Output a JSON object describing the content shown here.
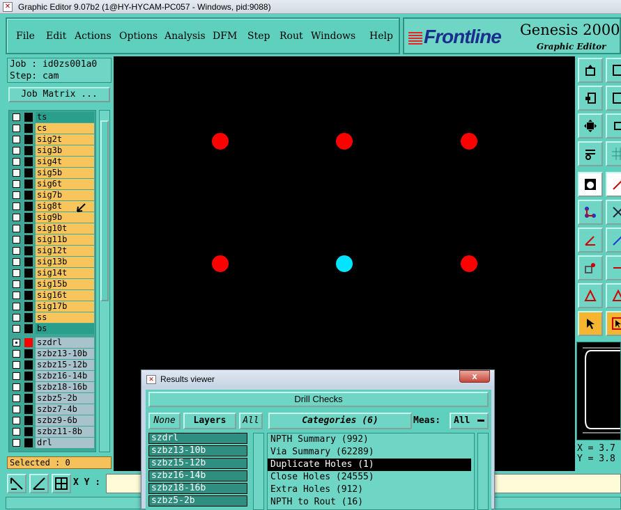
{
  "window": {
    "title": "Graphic Editor 9.07b2 (1@HY-HYCAM-PC057 - Windows, pid:9088)"
  },
  "menu": [
    "File",
    "Edit",
    "Actions",
    "Options",
    "Analysis",
    "DFM",
    "Step",
    "Rout",
    "Windows",
    "Help"
  ],
  "brand": {
    "logo": "Frontline",
    "product": "Genesis 2000",
    "subtitle": "Graphic Editor"
  },
  "job": {
    "job_line": "Job : id0zs001a0",
    "step_line": "Step: cam",
    "matrix_button": "Job Matrix ..."
  },
  "layers_board": [
    "ts",
    "cs",
    "sig2t",
    "sig3b",
    "sig4t",
    "sig5b",
    "sig6t",
    "sig7b",
    "sig8t",
    "sig9b",
    "sig10t",
    "sig11b",
    "sig12t",
    "sig13b",
    "sig14t",
    "sig15b",
    "sig16t",
    "sig17b",
    "ss",
    "bs"
  ],
  "layers_drill": [
    "szdrl",
    "szbz13-10b",
    "szbz15-12b",
    "szbz16-14b",
    "szbz18-16b",
    "szbz5-2b",
    "szbz7-4b",
    "szbz9-6b",
    "szbz11-8b",
    "drl"
  ],
  "selected": "Selected : 0",
  "coords": {
    "x": "X = 3.7",
    "y": "Y = 3.8"
  },
  "xy_label": "X Y :",
  "colors": {
    "red_dot": "#ff0000",
    "cyan_dot": "#00e5ff",
    "board_layer": "#f7c55b",
    "active_layer": "#2aa08c",
    "drill_layer": "#a9c3cc"
  },
  "results_viewer": {
    "title": "Results viewer",
    "close_glyph": "x",
    "header": "Drill Checks",
    "none_btn": "None",
    "layers_btn": "Layers",
    "all_btn": "All",
    "categories_btn": "Categories (6)",
    "meas_label": "Meas:",
    "meas_value": "All",
    "layers": [
      "szdrl",
      "szbz13-10b",
      "szbz15-12b",
      "szbz16-14b",
      "szbz18-16b",
      "szbz5-2b"
    ],
    "categories": [
      "NPTH Summary (992)",
      "Via Summary (62289)",
      "Duplicate Holes (1)",
      "Close Holes (24555)",
      "Extra Holes (912)",
      "NPTH to Rout (16)"
    ],
    "selected_category": "Duplicate Holes (1)"
  }
}
